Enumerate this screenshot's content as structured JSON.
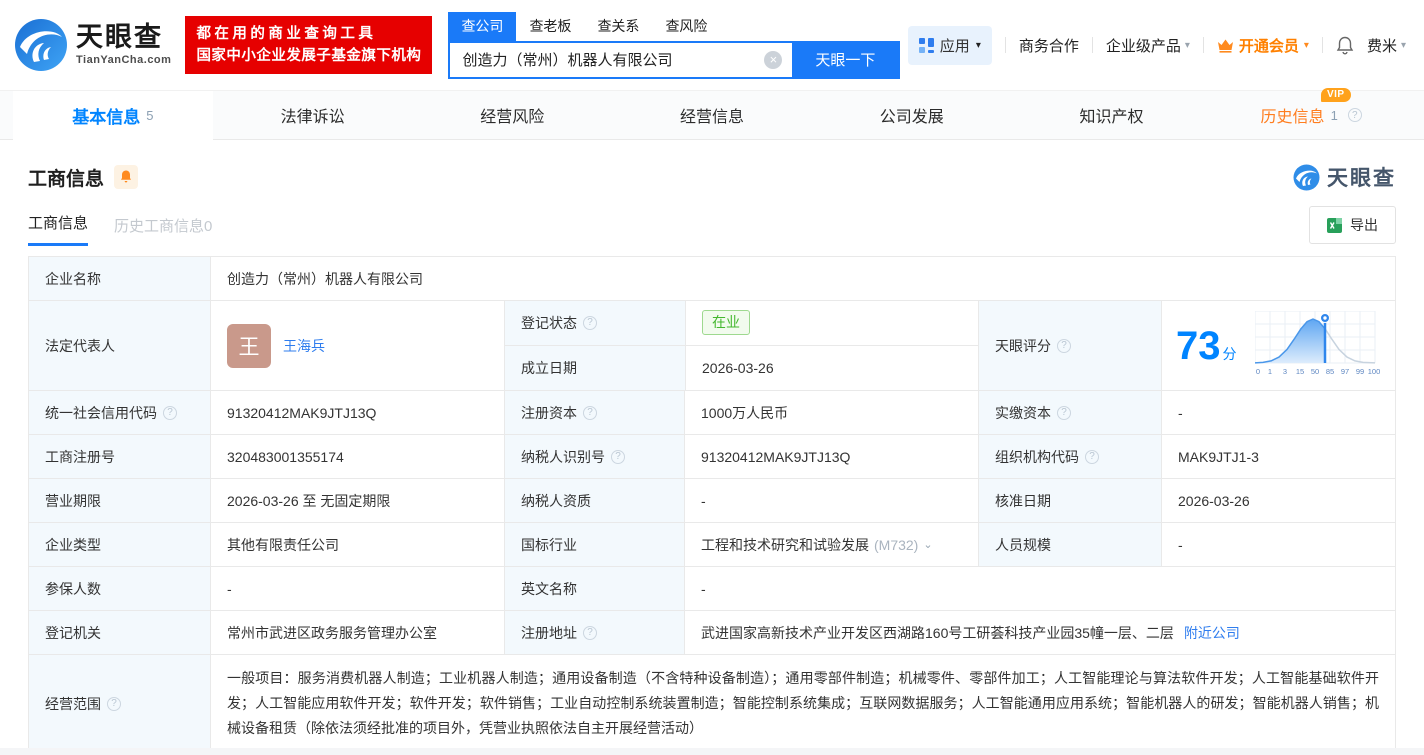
{
  "brand": {
    "name": "天眼查",
    "domain": "TianYanCha.com",
    "slogan_line1": "都在用的商业查询工具",
    "slogan_line2": "国家中小企业发展子基金旗下机构"
  },
  "search": {
    "tabs": [
      {
        "label": "查公司"
      },
      {
        "label": "查老板"
      },
      {
        "label": "查关系"
      },
      {
        "label": "查风险"
      }
    ],
    "value": "创造力（常州）机器人有限公司",
    "clear_icon": "×",
    "button_label": "天眼一下"
  },
  "topnav": {
    "apps_label": "应用",
    "cooperation_label": "商务合作",
    "enterprise_label": "企业级产品",
    "vip_label": "开通会员",
    "user_label": "费米",
    "caret": "▾"
  },
  "main_tabs": {
    "basic": {
      "label": "基本信息",
      "count": "5"
    },
    "lawsuit": {
      "label": "法律诉讼"
    },
    "risk": {
      "label": "经营风险"
    },
    "operation": {
      "label": "经营信息"
    },
    "development": {
      "label": "公司发展"
    },
    "ip": {
      "label": "知识产权"
    },
    "history": {
      "label": "历史信息",
      "badge": "VIP",
      "count": "1"
    }
  },
  "section": {
    "title": "工商信息",
    "subtab_active": "工商信息",
    "subtab_history": "历史工商信息0",
    "watermark": "天眼查",
    "export_label": "导出"
  },
  "help_icon": "?",
  "fields": {
    "company_name": {
      "label": "企业名称",
      "value": "创造力（常州）机器人有限公司"
    },
    "legal_rep": {
      "label": "法定代表人",
      "avatar": "王",
      "value": "王海兵"
    },
    "reg_status": {
      "label": "登记状态",
      "value": "在业"
    },
    "establish_date": {
      "label": "成立日期",
      "value": "2026-03-26"
    },
    "tyc_score": {
      "label": "天眼评分",
      "value": "73",
      "unit": "分"
    },
    "credit_code": {
      "label": "统一社会信用代码",
      "value": "91320412MAK9JTJ13Q"
    },
    "reg_capital": {
      "label": "注册资本",
      "value": "1000万人民币"
    },
    "paid_capital": {
      "label": "实缴资本",
      "value": "-"
    },
    "reg_number": {
      "label": "工商注册号",
      "value": "320483001355174"
    },
    "taxpayer_id": {
      "label": "纳税人识别号",
      "value": "91320412MAK9JTJ13Q"
    },
    "org_code": {
      "label": "组织机构代码",
      "value": "MAK9JTJ1-3"
    },
    "business_term": {
      "label": "营业期限",
      "value": "2026-03-26 至 无固定期限"
    },
    "taxpayer_quality": {
      "label": "纳税人资质",
      "value": "-"
    },
    "approval_date": {
      "label": "核准日期",
      "value": "2026-03-26"
    },
    "company_type": {
      "label": "企业类型",
      "value": "其他有限责任公司"
    },
    "industry": {
      "label": "国标行业",
      "value": "工程和技术研究和试验发展",
      "code": "(M732)"
    },
    "staff_size": {
      "label": "人员规模",
      "value": "-"
    },
    "insured_count": {
      "label": "参保人数",
      "value": "-"
    },
    "english_name": {
      "label": "英文名称",
      "value": "-"
    },
    "reg_authority": {
      "label": "登记机关",
      "value": "常州市武进区政务服务管理办公室"
    },
    "reg_address": {
      "label": "注册地址",
      "value": "武进国家高新技术产业开发区西湖路160号工研荟科技产业园35幢一层、二层",
      "link": "附近公司"
    },
    "business_scope": {
      "label": "经营范围",
      "value": "一般项目：服务消费机器人制造；工业机器人制造；通用设备制造（不含特种设备制造）；通用零部件制造；机械零件、零部件加工；人工智能理论与算法软件开发；人工智能基础软件开发；人工智能应用软件开发；软件开发；软件销售；工业自动控制系统装置制造；智能控制系统集成；互联网数据服务；人工智能通用应用系统；智能机器人的研发；智能机器人销售；机械设备租赁（除依法须经批准的项目外，凭营业执照依法自主开展经营活动）"
    }
  },
  "score_chart": {
    "type": "area",
    "score": 73,
    "ticks": [
      "0",
      "1",
      "3",
      "15",
      "50",
      "85",
      "97",
      "99",
      "100"
    ]
  },
  "colors": {
    "accent_blue": "#0084ff",
    "button_blue": "#1a7af8",
    "brand_red": "#e60000",
    "vip_orange": "#ff8a1e",
    "status_green": "#44b72e",
    "label_bg": "#f3f9fd"
  }
}
